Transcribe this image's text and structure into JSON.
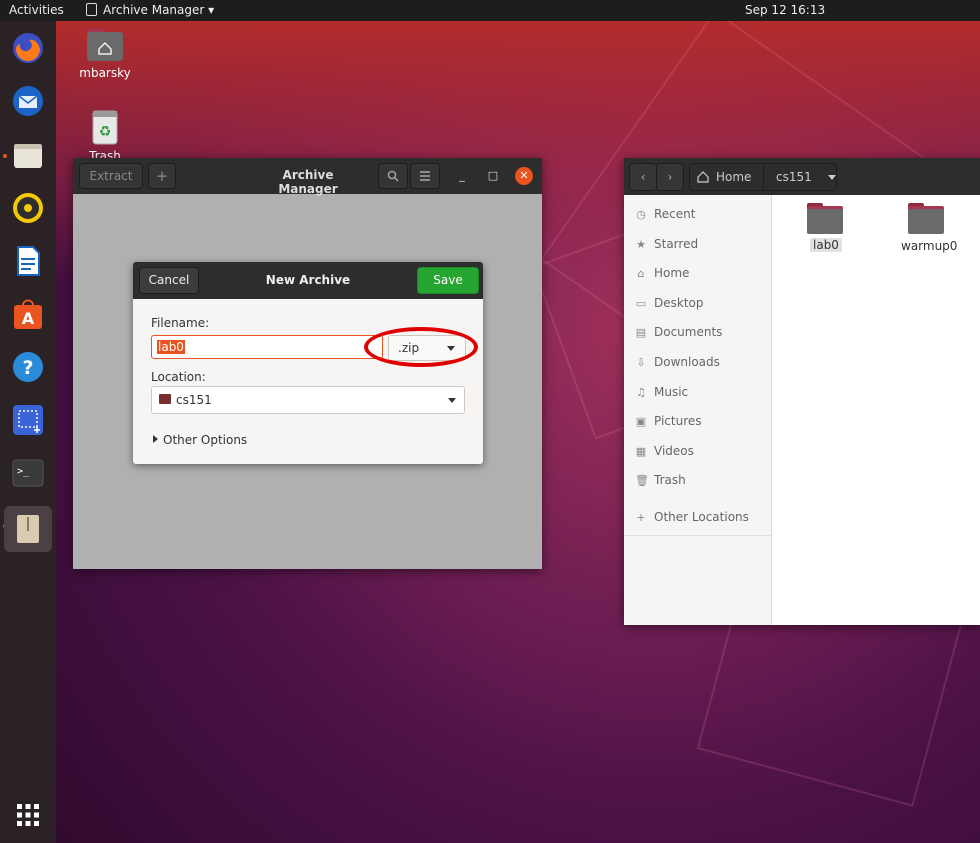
{
  "topbar": {
    "activities": "Activities",
    "app_menu": "Archive Manager ▾",
    "clock": "Sep 12  16:13"
  },
  "dock": {
    "items": [
      "firefox",
      "thunderbird",
      "files",
      "rhythmbox",
      "libreoffice-writer",
      "ubuntu-software",
      "help",
      "screenshot",
      "terminal",
      "archive-manager",
      "show-applications"
    ]
  },
  "desktop": {
    "icons": [
      {
        "label": "mbarsky",
        "icon": "home-folder-icon"
      },
      {
        "label": "Trash",
        "icon": "trash-icon"
      }
    ]
  },
  "archive_manager": {
    "title": "Archive Manager",
    "extract_label": "Extract",
    "add_label": "+",
    "search_icon": "search-icon",
    "menu_icon": "hamburger-icon"
  },
  "new_archive_dialog": {
    "title": "New Archive",
    "cancel_label": "Cancel",
    "save_label": "Save",
    "filename_label": "Filename:",
    "filename_value": "lab0",
    "extension_value": ".zip",
    "location_label": "Location:",
    "location_value": "cs151",
    "other_options_label": "Other Options",
    "colors": {
      "save": "#26a531",
      "focus": "#e95420"
    }
  },
  "files": {
    "breadcrumb": {
      "home": "Home",
      "current": "cs151"
    },
    "sidebar": [
      {
        "label": "Recent",
        "icon": "clock-icon"
      },
      {
        "label": "Starred",
        "icon": "star-icon"
      },
      {
        "label": "Home",
        "icon": "home-icon"
      },
      {
        "label": "Desktop",
        "icon": "desktop-icon"
      },
      {
        "label": "Documents",
        "icon": "document-icon"
      },
      {
        "label": "Downloads",
        "icon": "download-icon"
      },
      {
        "label": "Music",
        "icon": "music-icon"
      },
      {
        "label": "Pictures",
        "icon": "picture-icon"
      },
      {
        "label": "Videos",
        "icon": "video-icon"
      },
      {
        "label": "Trash",
        "icon": "trash-icon"
      }
    ],
    "other_locations": "Other Locations",
    "folders": [
      "lab0",
      "warmup0"
    ]
  }
}
